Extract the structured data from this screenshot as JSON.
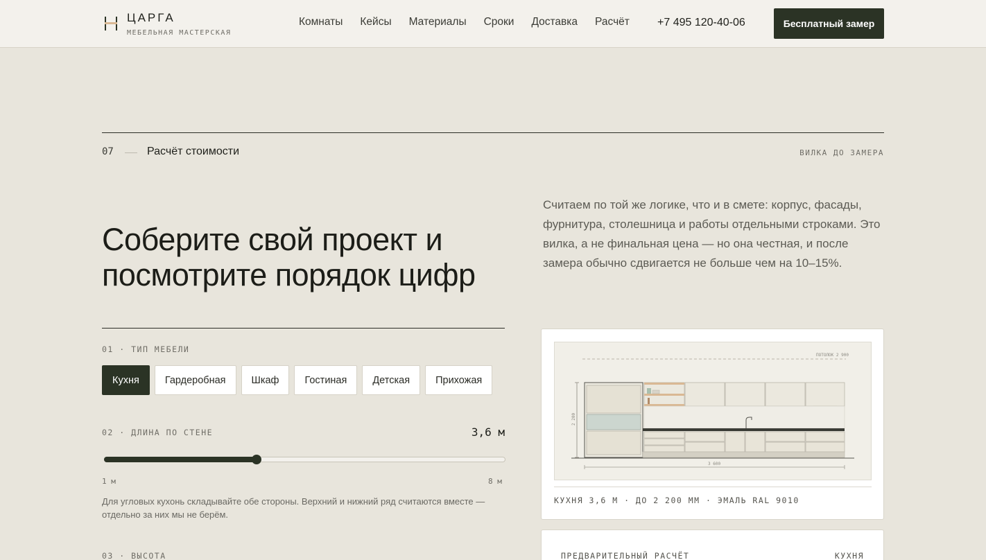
{
  "header": {
    "brand": "ЦАРГА",
    "brand_sub": "МЕБЕЛЬНАЯ МАСТЕРСКАЯ",
    "nav": [
      "Комнаты",
      "Кейсы",
      "Материалы",
      "Сроки",
      "Доставка",
      "Расчёт"
    ],
    "phone": "+7 495 120-40-06",
    "cta": "Бесплатный замер"
  },
  "section": {
    "number": "07",
    "title": "Расчёт стоимости",
    "tag": "ВИЛКА ДО ЗАМЕРА",
    "heading": "Соберите свой проект и посмотрите порядок цифр",
    "lead": "Считаем по той же логике, что и в смете: корпус, фасады, фурнитура, столешница и работы отдельными строками. Это вилка, а не финальная цена — но она честная, и после замера обычно сдвигается не больше чем на 10–15%."
  },
  "form": {
    "type_label": "01 · ТИП МЕБЕЛИ",
    "types": [
      "Кухня",
      "Гардеробная",
      "Шкаф",
      "Гостиная",
      "Детская",
      "Прихожая"
    ],
    "selected_type": "Кухня",
    "length_label": "02 · ДЛИНА ПО СТЕНЕ",
    "length_value": "3,6 м",
    "length_min": "1 м",
    "length_max": "8 м",
    "length_fraction": 0.38,
    "length_hint": "Для угловых кухонь складывайте обе стороны. Верхний и нижний ряд считаются вместе — отдельно за них мы не берём.",
    "height_label": "03 · ВЫСОТА"
  },
  "preview": {
    "ceiling_label": "ПОТОЛОК 2 900",
    "height_dim": "2 200",
    "width_dim": "3 600",
    "caption": "КУХНЯ 3,6 М · ДО 2 200 ММ · ЭМАЛЬ RAL 9010"
  },
  "estimate": {
    "title": "ПРЕДВАРИТЕЛЬНЫЙ РАСЧЁТ",
    "type": "КУХНЯ"
  },
  "colors": {
    "background": "#e8e5dc",
    "accent": "#2b3325",
    "wood": "#d9b893"
  }
}
